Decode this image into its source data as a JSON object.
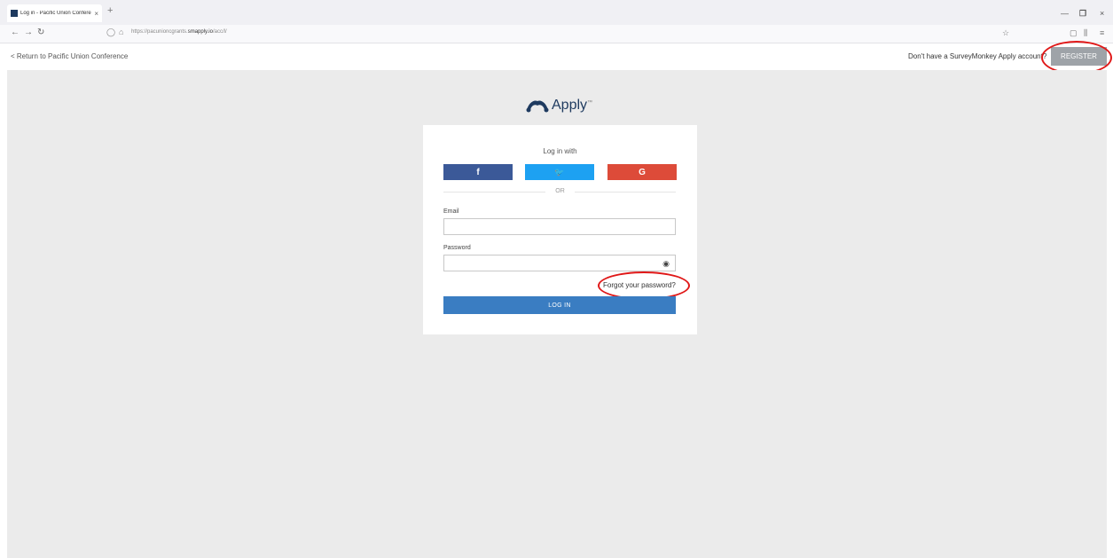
{
  "browser": {
    "tab_title": "Log in - Pacific Union Confere",
    "tab_close": "×",
    "new_tab": "+",
    "url_prefix": "https://pacunioncgrants.",
    "url_host": "smapply.io",
    "url_path": "/acc/l/",
    "window_minimize": "—",
    "window_restore": "❐",
    "window_close": "×"
  },
  "header": {
    "back_link": "< Return to Pacific Union Conference",
    "no_account_text": "Don't have a SurveyMonkey Apply account?",
    "register_label": "REGISTER"
  },
  "logo": {
    "text": "Apply",
    "tm": "™"
  },
  "login": {
    "heading": "Log in with",
    "facebook_label": "f",
    "twitter_label": "🐦",
    "google_label": "G",
    "or_text": "OR",
    "email_label": "Email",
    "email_value": "",
    "password_label": "Password",
    "password_value": "",
    "forgot_link": "Forgot your password?",
    "login_button": "LOG IN"
  },
  "icons": {
    "back": "arrow-left-icon",
    "forward": "arrow-right-icon",
    "reload": "reload-icon",
    "shield": "shield-icon",
    "lock": "lock-icon",
    "star": "star-icon",
    "pocket": "pocket-icon",
    "library": "library-icon",
    "menu": "menu-icon",
    "eye": "eye-icon",
    "logo": "surveymonkey-logo-icon"
  },
  "colors": {
    "facebook": "#3b5998",
    "twitter": "#1da1f2",
    "google": "#dd4b39",
    "login": "#3a7dc2",
    "register": "#9ea3a8",
    "highlight": "#e01818",
    "brand": "#1e3a5f"
  }
}
